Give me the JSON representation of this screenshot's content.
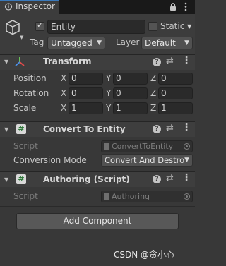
{
  "window": {
    "tab_title": "Inspector",
    "tab_icon": "info-icon",
    "lock_icon": "lock-icon",
    "menu_icon": "kebab-menu-icon"
  },
  "gameobject": {
    "icon": "cube-icon",
    "active": true,
    "name": "Entity",
    "static_label": "Static",
    "static_checked": false,
    "tag_label": "Tag",
    "tag_value": "Untagged",
    "layer_label": "Layer",
    "layer_value": "Default"
  },
  "transform": {
    "title": "Transform",
    "icon": "transform-axes-icon",
    "rows": [
      {
        "label": "Position",
        "x": "0",
        "y": "0",
        "z": "0"
      },
      {
        "label": "Rotation",
        "x": "0",
        "y": "0",
        "z": "0"
      },
      {
        "label": "Scale",
        "x": "1",
        "y": "1",
        "z": "1"
      }
    ],
    "axis_labels": [
      "X",
      "Y",
      "Z"
    ]
  },
  "convert": {
    "title": "Convert To Entity",
    "icon": "script-hash-icon",
    "enabled": true,
    "script_label": "Script",
    "script_value": "ConvertToEntity",
    "mode_label": "Conversion Mode",
    "mode_value": "Convert And Destro"
  },
  "authoring": {
    "title": "Authoring (Script)",
    "icon": "script-hash-icon",
    "enabled": true,
    "script_label": "Script",
    "script_value": "Authoring"
  },
  "add_component_label": "Add Component",
  "watermark": "CSDN @贪小心",
  "colors": {
    "accent": "#3a79bb",
    "background": "#383838",
    "header": "#3e3e3e"
  }
}
